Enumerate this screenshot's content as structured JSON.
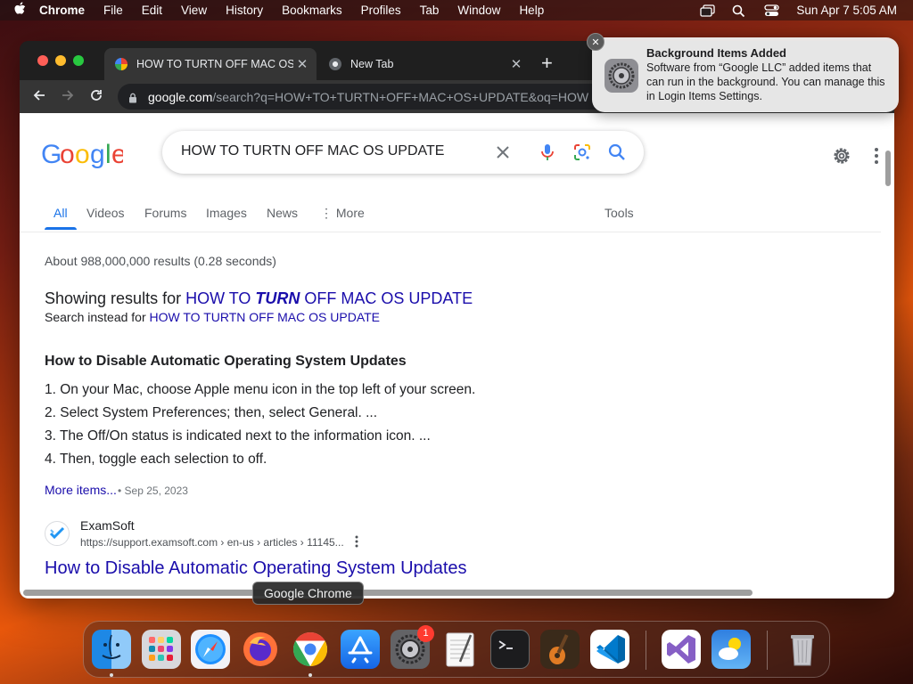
{
  "menubar": {
    "app_name": "Chrome",
    "items": [
      "File",
      "Edit",
      "View",
      "History",
      "Bookmarks",
      "Profiles",
      "Tab",
      "Window",
      "Help"
    ],
    "clock": "Sun Apr 7  5:05 AM"
  },
  "browser": {
    "tabs": [
      {
        "title": "HOW TO TURTN OFF MAC OS",
        "active": true
      },
      {
        "title": "New Tab",
        "active": false
      }
    ],
    "url_host": "google.com",
    "url_rest": "/search?q=HOW+TO+TURTN+OFF+MAC+OS+UPDATE&oq=HOW"
  },
  "google": {
    "query": "HOW TO TURTN OFF MAC OS UPDATE",
    "tabs": [
      "All",
      "Videos",
      "Forums",
      "Images",
      "News",
      "⋮ More"
    ],
    "tools_label": "Tools",
    "stats": "About 988,000,000 results (0.28 seconds)",
    "showing_prefix": "Showing results for ",
    "corrected_a": "HOW TO ",
    "corrected_b": "TURN",
    "corrected_c": " OFF MAC OS UPDATE",
    "instead_prefix": "Search instead for ",
    "instead_query": "HOW TO TURTN OFF MAC OS UPDATE",
    "snippet_title": "How to Disable Automatic Operating System Updates",
    "steps": [
      "1. On your Mac, choose Apple menu icon in the top left of your screen.",
      "2. Select System Preferences; then, select General. ...",
      "3. The Off/On status is indicated next to the information icon. ...",
      "4. Then, toggle each selection to off."
    ],
    "more_items": "More items...",
    "more_date": "• Sep 25, 2023",
    "result": {
      "site": "ExamSoft",
      "url": "https://support.examsoft.com › en-us › articles › 11145...",
      "title": "How to Disable Automatic Operating System Updates"
    }
  },
  "notification": {
    "title": "Background Items Added",
    "body": "Software from “Google LLC” added items that can run in the background. You can manage this in Login Items Settings."
  },
  "dock": {
    "tooltip": "Google Chrome",
    "badge": "1",
    "apps": [
      "Finder",
      "Launchpad",
      "Safari",
      "Firefox",
      "Google Chrome",
      "App Store",
      "System Settings",
      "TextEdit",
      "Terminal",
      "GarageBand",
      "Visual Studio Code",
      "Visual Studio",
      "Weather",
      "Trash"
    ]
  },
  "colors": {
    "google_blue": "#4285f4",
    "google_red": "#ea4335",
    "google_yellow": "#fbbc05",
    "google_green": "#34a853",
    "link": "#1a0dab"
  }
}
